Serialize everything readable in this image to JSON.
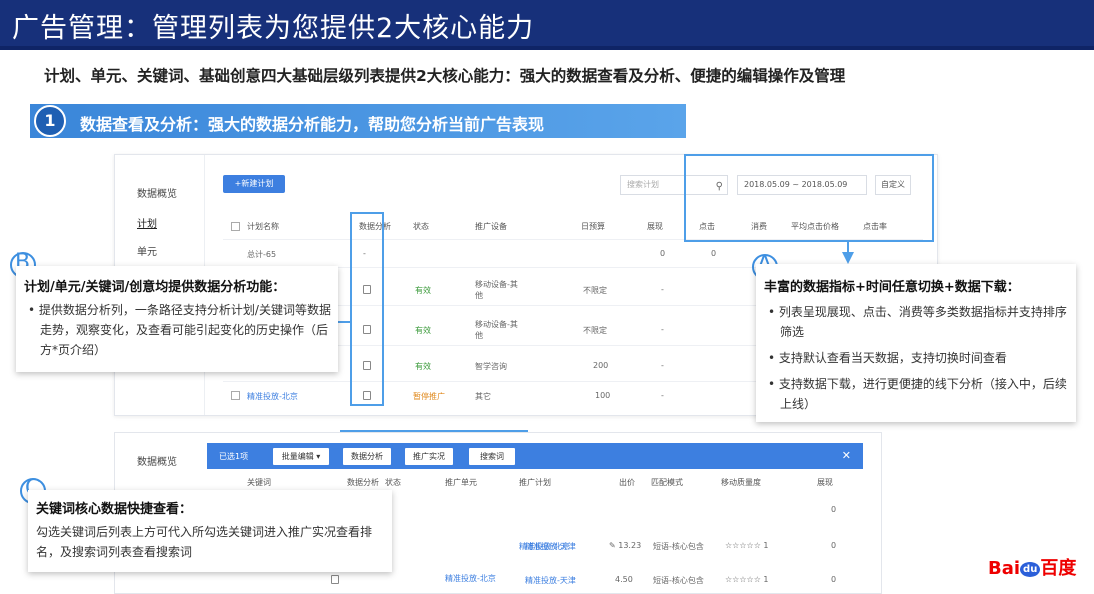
{
  "title": "广告管理：管理列表为您提供2大核心能力",
  "subtitle": "计划、单元、关键词、基础创意四大基础层级列表提供2大核心能力：强大的数据查看及分析、便捷的编辑操作及管理",
  "section": {
    "number": "1",
    "text": "数据查看及分析：强大的数据分析能力，帮助您分析当前广告表现"
  },
  "top_shot": {
    "sidebar": [
      "数据概览",
      "计划",
      "单元"
    ],
    "new_button": "+新建计划",
    "search_placeholder": "搜索计划",
    "date_range": "2018.05.09 ~ 2018.05.09",
    "custom_button": "自定义",
    "headers": [
      "计划名称",
      "数据分析",
      "状态",
      "推广设备",
      "日预算",
      "展现",
      "点击",
      "消费",
      "平均点击价格",
      "点击率"
    ],
    "rows": [
      {
        "name": "总计-65",
        "status": "",
        "device": "",
        "budget": "",
        "impr": "0",
        "clicks": "0"
      },
      {
        "name": "",
        "status": "有效",
        "device": "移动设备-其他",
        "budget": "不限定",
        "impr": "-",
        "clicks": "-"
      },
      {
        "name": "",
        "status": "有效",
        "device": "移动设备-其他",
        "budget": "不限定",
        "impr": "-",
        "clicks": "-"
      },
      {
        "name": "",
        "status": "有效",
        "device": "智学咨询",
        "budget": "200",
        "impr": "-",
        "clicks": "-"
      },
      {
        "name": "精准投放-北京",
        "status": "暂停推广",
        "device": "其它",
        "budget": "100",
        "impr": "-",
        "clicks": "-"
      }
    ]
  },
  "callout_a": {
    "letter": "A",
    "title": "丰富的数据指标+时间任意切换+数据下载：",
    "items": [
      "列表呈现展现、点击、消费等多类数据指标并支持排序筛选",
      "支持默认查看当天数据，支持切换时间查看",
      "支持数据下载，进行更便捷的线下分析（接入中，后续上线）"
    ]
  },
  "callout_b": {
    "letter": "B",
    "title": "计划/单元/关键词/创意均提供数据分析功能：",
    "items": [
      "提供数据分析列，一条路径支持分析计划/关键词等数据走势，观察变化，及查看可能引起变化的历史操作（后方*页介绍）"
    ]
  },
  "callout_c": {
    "letter": "C",
    "title": "关键词核心数据快捷查看：",
    "body": "勾选关键词后列表上方可代入所勾选关键词进入推广实况查看排名，及搜索词列表查看搜索词"
  },
  "bottom_shot": {
    "sidebar": [
      "数据概览"
    ],
    "selected": "已选1项",
    "batch_button": "批量编辑",
    "buttons": [
      "数据分析",
      "推广实况",
      "搜索词"
    ],
    "headers": [
      "关键词",
      "数据分析",
      "状态",
      "推广单元",
      "推广计划",
      "出价",
      "匹配模式",
      "移动质量度",
      "展现"
    ],
    "rows": [
      {
        "unit": "精准投放-北京",
        "plan": "精准投放-天津",
        "bid": "13.23",
        "match": "短语-核心包含",
        "qs": "1",
        "impr": "0"
      },
      {
        "unit": "精准投放-北京",
        "plan": "精准投放-天津",
        "bid": "4.50",
        "match": "短语-核心包含",
        "qs": "1",
        "impr": "0"
      }
    ]
  },
  "logo": {
    "bai": "Bai",
    "du": "du",
    "cn": "百度"
  },
  "colors": {
    "title_bg": "#17307a",
    "accent": "#3d7fe0",
    "highlight": "#4e9ee8"
  }
}
